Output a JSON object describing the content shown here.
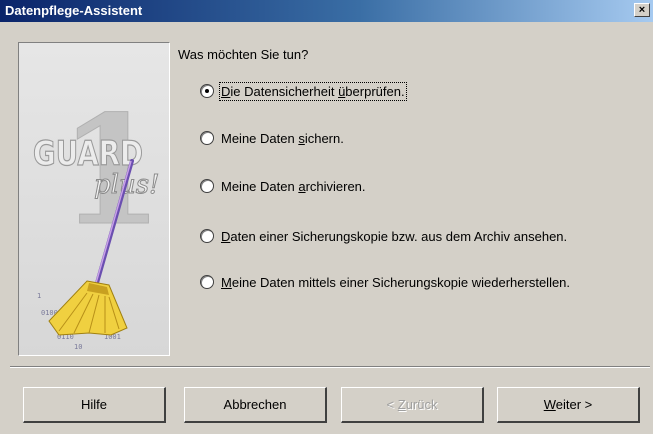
{
  "window": {
    "title": "Datenpflege-Assistent",
    "close_glyph": "×"
  },
  "illustration": {
    "logo_number": "1",
    "logo_word": "GUARD",
    "logo_sub": "plus!",
    "icon": "broom-with-data-dust"
  },
  "question": "Was möchten Sie tun?",
  "options": [
    {
      "pre": "",
      "accel": "D",
      "post": "ie Datensicherheit ",
      "accel2": "ü",
      "post2": "berprüfen.",
      "selected": true
    },
    {
      "pre": "Meine Daten ",
      "accel": "s",
      "post": "ichern.",
      "selected": false
    },
    {
      "pre": "Meine Daten ",
      "accel": "a",
      "post": "rchivieren.",
      "selected": false
    },
    {
      "pre": "",
      "accel": "D",
      "post": "aten einer Sicherungskopie bzw. aus dem Archiv ansehen.",
      "selected": false
    },
    {
      "pre": "",
      "accel": "M",
      "post": "eine Daten mittels einer Sicherungskopie wiederherstellen.",
      "selected": false
    }
  ],
  "buttons": {
    "help": "Hilfe",
    "cancel": "Abbrechen",
    "back_accel": "Z",
    "back_rest": "urück",
    "back_prefix": "< ",
    "next_accel": "W",
    "next_rest": "eiter >"
  },
  "colors": {
    "dialog_bg": "#d4d0c8",
    "title_gradient_start": "#0a246a",
    "title_gradient_end": "#a6caf0"
  }
}
